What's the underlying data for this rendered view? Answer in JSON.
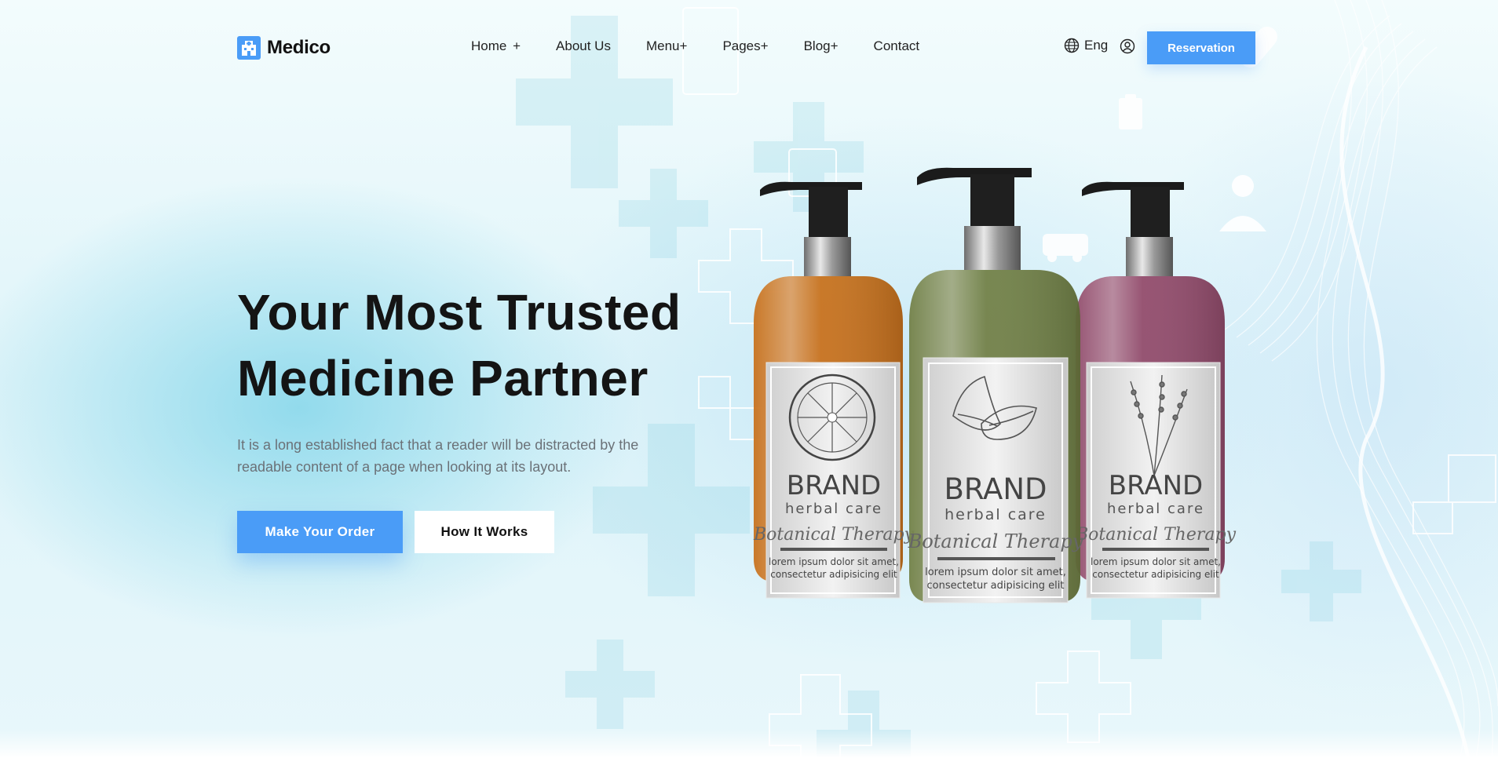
{
  "brand": {
    "name": "Medico"
  },
  "nav": {
    "items": [
      {
        "label": "Home",
        "suffix": "+"
      },
      {
        "label": "About Us",
        "suffix": ""
      },
      {
        "label": "Menu",
        "suffix": "+"
      },
      {
        "label": "Pages",
        "suffix": "+"
      },
      {
        "label": "Blog",
        "suffix": "+"
      },
      {
        "label": "Contact",
        "suffix": ""
      }
    ]
  },
  "header": {
    "language": "Eng",
    "reservation_label": "Reservation"
  },
  "hero": {
    "title_line1": "Your Most Trusted",
    "title_line2": "Medicine Partner",
    "description": "It is a long established fact that a reader will be distracted by the readable content of a page when looking at its layout.",
    "primary_button": "Make Your Order",
    "secondary_button": "How It Works"
  },
  "products": [
    {
      "brand": "BRAND",
      "line": "herbal care",
      "script": "Botanical Therapy",
      "body1": "lorem ipsum dolor sit amet,",
      "body2": "consectetur adipisicing elit",
      "color": "#c56a12",
      "illustration": "citrus-slice-icon"
    },
    {
      "brand": "BRAND",
      "line": "herbal care",
      "script": "Botanical Therapy",
      "body1": "lorem ipsum dolor sit amet,",
      "body2": "consectetur adipisicing elit",
      "color": "#6b7a3e",
      "illustration": "leaf-icon"
    },
    {
      "brand": "BRAND",
      "line": "herbal care",
      "script": "Botanical Therapy",
      "body1": "lorem ipsum dolor sit amet,",
      "body2": "consectetur adipisicing elit",
      "color": "#8a3a5c",
      "illustration": "lavender-icon"
    }
  ],
  "colors": {
    "accent": "#4a9cf7",
    "heading": "#141414",
    "body": "#6b7177"
  }
}
